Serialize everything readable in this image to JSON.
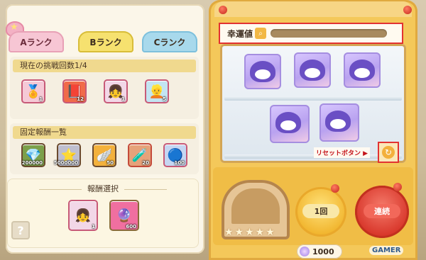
{
  "tabs": [
    {
      "label": "Aランク"
    },
    {
      "label": "Bランク"
    },
    {
      "label": "Cランク"
    }
  ],
  "challenge": {
    "header": "現在の挑戦回数1/4",
    "items": [
      {
        "icon": "gold-medal-icon",
        "count": "1",
        "color": "#f5c9d6"
      },
      {
        "icon": "red-book-icon",
        "count": "12",
        "color": "#f06b4a"
      },
      {
        "icon": "character-portrait-icon",
        "count": "1",
        "color": "#f2d7e7"
      },
      {
        "icon": "character-portrait-icon",
        "count": "5",
        "color": "#c3e4f2"
      }
    ]
  },
  "fixed_rewards": {
    "header": "固定報酬一覧",
    "items": [
      {
        "icon": "green-crystal-icon",
        "count": "200000",
        "color": "#7ca04a"
      },
      {
        "icon": "star-icon",
        "count": "5000000",
        "color": "#bfbfcf"
      },
      {
        "icon": "wing-icon",
        "count": "50",
        "color": "#f3b13c"
      },
      {
        "icon": "potion-icon",
        "count": "20",
        "color": "#e6a27a"
      },
      {
        "icon": "blue-orb-icon",
        "count": "100",
        "color": "#c5d6f2"
      }
    ]
  },
  "reward_select": {
    "title": "報酬選択",
    "items": [
      {
        "icon": "character-portrait-icon",
        "count": "1",
        "color": "#f2d7e7"
      },
      {
        "icon": "pink-orb-icon",
        "count": "600",
        "color": "#f06fa0"
      }
    ]
  },
  "help": {
    "label": "?"
  },
  "luck": {
    "label": "幸運値",
    "icon": "search-icon"
  },
  "reset": {
    "label": "リセットボタン ▶",
    "icon": "refresh-icon"
  },
  "buttons": {
    "one": "1回",
    "continuous": "連続"
  },
  "currency": {
    "value": "1000"
  },
  "hatch_stars": "★★★★★",
  "watermark": "GAMER"
}
